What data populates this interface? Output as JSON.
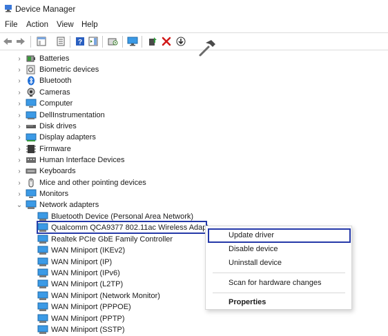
{
  "window": {
    "title": "Device Manager"
  },
  "menu": [
    "File",
    "Action",
    "View",
    "Help"
  ],
  "toolbar": {
    "buttons": [
      "back-icon",
      "forward-icon",
      "console-tree-icon",
      "properties-icon",
      "help-icon",
      "action-pane-icon",
      "scan-hardware-icon",
      "monitor-icon",
      "update-driver-icon",
      "uninstall-icon",
      "download-icon"
    ]
  },
  "tree": {
    "categories": [
      "Batteries",
      "Biometric devices",
      "Bluetooth",
      "Cameras",
      "Computer",
      "DellInstrumentation",
      "Disk drives",
      "Display adapters",
      "Firmware",
      "Human Interface Devices",
      "Keyboards",
      "Mice and other pointing devices",
      "Monitors",
      "Network adapters"
    ],
    "network_children": [
      "Bluetooth Device (Personal Area Network)",
      "Qualcomm QCA9377 802.11ac Wireless Adapter",
      "Realtek PCIe GbE Family Controller",
      "WAN Miniport (IKEv2)",
      "WAN Miniport (IP)",
      "WAN Miniport (IPv6)",
      "WAN Miniport (L2TP)",
      "WAN Miniport (Network Monitor)",
      "WAN Miniport (PPPOE)",
      "WAN Miniport (PPTP)",
      "WAN Miniport (SSTP)"
    ],
    "selected": "Qualcomm QCA9377 802.11ac Wireless Adapter"
  },
  "context_menu": {
    "items": [
      "Update driver",
      "Disable device",
      "Uninstall device",
      "Scan for hardware changes",
      "Properties"
    ],
    "highlighted": "Update driver"
  },
  "colors": {
    "highlight_border": "#2438a8",
    "network_icon": "#2a8fd8"
  }
}
